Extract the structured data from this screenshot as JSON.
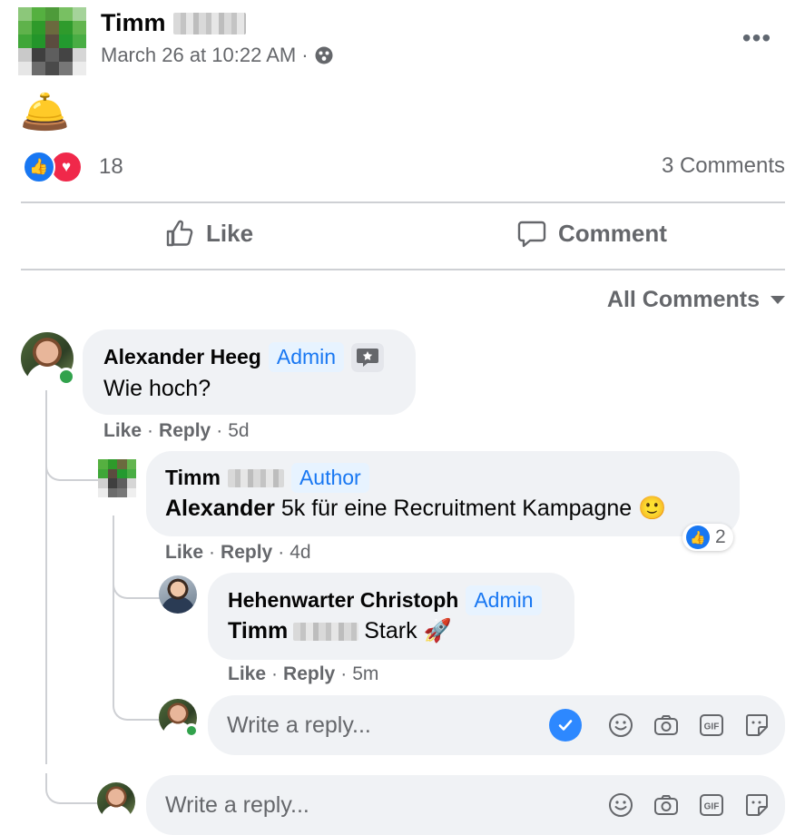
{
  "post": {
    "author": "Timm",
    "timestamp": "March 26 at 10:22 AM",
    "meta_separator": "·",
    "audience_icon": "globe-icon",
    "content_emoji": "🛎️",
    "reaction_count": "18",
    "comment_count": "3 Comments"
  },
  "actions": {
    "like": "Like",
    "comment": "Comment"
  },
  "sort_label": "All Comments",
  "comments": [
    {
      "name": "Alexander Heeg",
      "badge": "Admin",
      "text": "Wie hoch?",
      "like": "Like",
      "reply": "Reply",
      "time": "5d",
      "replies": [
        {
          "name": "Timm",
          "badge": "Author",
          "mention": "Alexander",
          "text": "5k für eine Recruitment Kampagne 🙂",
          "like": "Like",
          "reply": "Reply",
          "time": "4d",
          "reaction_count": "2"
        },
        {
          "name": "Hehenwarter Christoph",
          "badge": "Admin",
          "mention": "Timm",
          "text": "Stark 🚀",
          "like": "Like",
          "reply": "Reply",
          "time": "5m"
        }
      ]
    }
  ],
  "reply_box": {
    "placeholder": "Write a reply..."
  },
  "bottom_reply_box": {
    "placeholder": "Write a reply..."
  },
  "colors": {
    "accent": "#1877f2",
    "love": "#f0284a",
    "online": "#31a24c",
    "muted": "#65676b",
    "bubble": "#f0f2f5"
  }
}
